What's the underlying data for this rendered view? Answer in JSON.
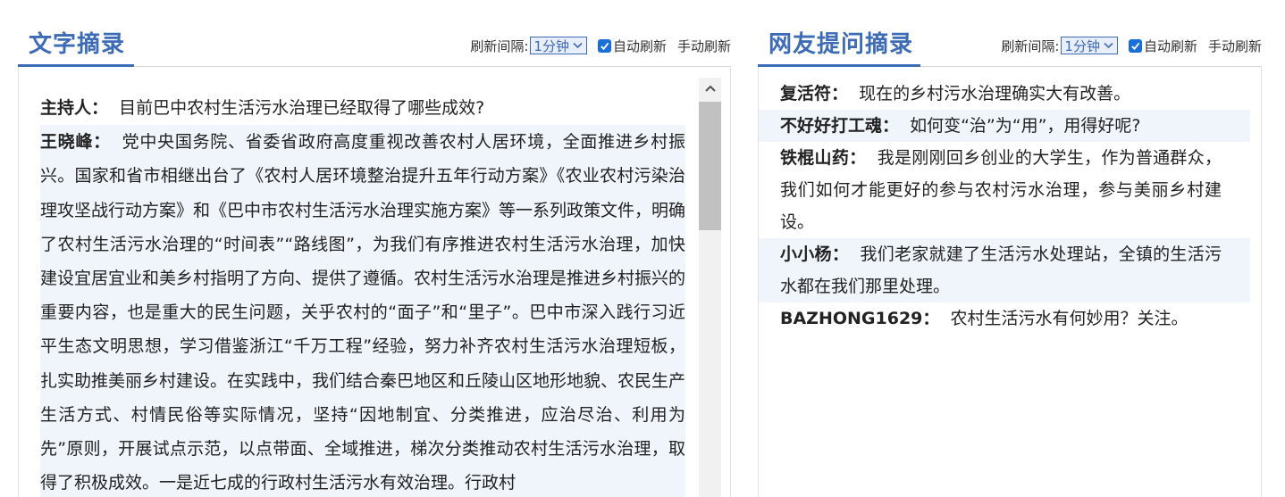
{
  "left": {
    "title": "文字摘录",
    "controls": {
      "interval_label": "刷新间隔:",
      "interval_value": "1分钟",
      "auto_label": "自动刷新",
      "manual_label": "手动刷新"
    },
    "entries": [
      {
        "speaker": "主持人：",
        "text": "目前巴中农村生活污水治理已经取得了哪些成效?"
      },
      {
        "speaker": "王晓峰：",
        "text": "党中央国务院、省委省政府高度重视改善农村人居环境，全面推进乡村振兴。国家和省市相继出台了《农村人居环境整治提升五年行动方案》《农业农村污染治理攻坚战行动方案》和《巴中市农村生活污水治理实施方案》等一系列政策文件，明确了农村生活污水治理的“时间表”“路线图”，为我们有序推进农村生活污水治理，加快建设宜居宜业和美乡村指明了方向、提供了遵循。农村生活污水治理是推进乡村振兴的重要内容，也是重大的民生问题，关乎农村的“面子”和“里子”。巴中市深入践行习近平生态文明思想，学习借鉴浙江“千万工程”经验，努力补齐农村生活污水治理短板，扎实助推美丽乡村建设。在实践中，我们结合秦巴地区和丘陵山区地形地貌、农民生产生活方式、村情民俗等实际情况，坚持“因地制宜、分类推进，应治尽治、利用为先”原则，开展试点示范，以点带面、全域推进，梯次分类推动农村生活污水治理，取得了积极成效。一是近七成的行政村生活污水有效治理。行政村"
      }
    ]
  },
  "right": {
    "title": "网友提问摘录",
    "controls": {
      "interval_label": "刷新间隔:",
      "interval_value": "1分钟",
      "auto_label": "自动刷新",
      "manual_label": "手动刷新"
    },
    "entries": [
      {
        "speaker": "复活符：",
        "text": "现在的乡村污水治理确实大有改善。"
      },
      {
        "speaker": "不好好打工魂：",
        "text": "如何变“治”为“用”，用得好呢?"
      },
      {
        "speaker": "铁棍山药：",
        "text": "我是刚刚回乡创业的大学生，作为普通群众，我们如何才能更好的参与农村污水治理，参与美丽乡村建设。"
      },
      {
        "speaker": "小小杨：",
        "text": "我们老家就建了生活污水处理站，全镇的生活污水都在我们那里处理。"
      },
      {
        "speaker": "BAZHONG1629：",
        "text": "农村生活污水有何妙用？关注。"
      }
    ]
  },
  "colors": {
    "accent": "#3d6bb5",
    "alt_row": "#eff5fb",
    "checkbox": "#1a6fd6"
  }
}
